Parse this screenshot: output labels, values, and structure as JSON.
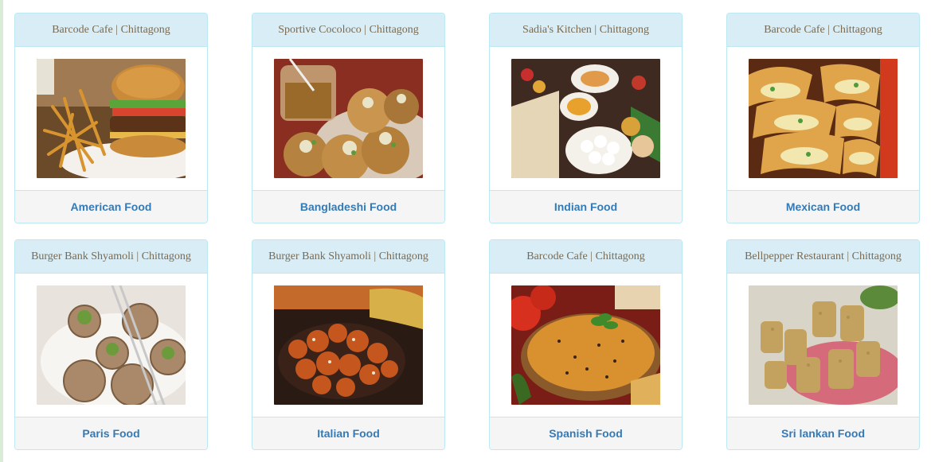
{
  "cards": [
    {
      "restaurant": "Barcode Cafe | Chittagong",
      "food": "American Food",
      "image": "burger-fries-photo"
    },
    {
      "restaurant": "Sportive Cocoloco | Chittagong",
      "food": "Bangladeshi Food",
      "image": "fuchka-photo"
    },
    {
      "restaurant": "Sadia's Kitchen | Chittagong",
      "food": "Indian Food",
      "image": "indian-platter-photo"
    },
    {
      "restaurant": "Barcode Cafe | Chittagong",
      "food": "Mexican Food",
      "image": "tacos-photo"
    },
    {
      "restaurant": "Burger Bank Shyamoli | Chittagong",
      "food": "Paris Food",
      "image": "escargot-photo"
    },
    {
      "restaurant": "Burger Bank Shyamoli | Chittagong",
      "food": "Italian Food",
      "image": "chicken-manchurian-photo"
    },
    {
      "restaurant": "Barcode Cafe | Chittagong",
      "food": "Spanish Food",
      "image": "spanish-rice-photo"
    },
    {
      "restaurant": "Bellpepper Restaurant | Chittagong",
      "food": "Sri lankan Food",
      "image": "sweets-photo"
    }
  ],
  "colors": {
    "header_bg": "#d9edf7",
    "border": "#bce8f1",
    "link": "#337ab7",
    "footer_bg": "#f5f5f5"
  }
}
